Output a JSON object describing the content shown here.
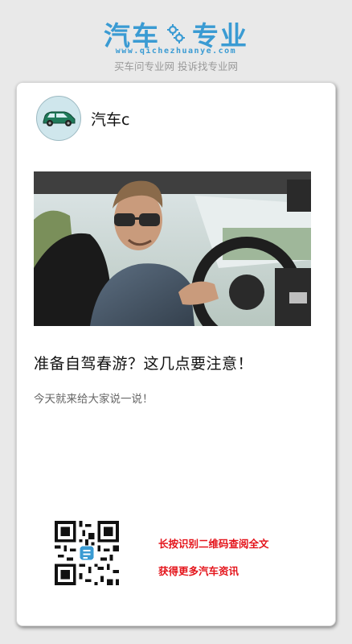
{
  "header": {
    "logo_left": "汽车",
    "logo_right": "专业",
    "domain": "www.qichezhuanye.com",
    "slogan": "买车问专业网 投诉找专业网"
  },
  "author": {
    "name": "汽车c",
    "avatar_icon": "car-icon"
  },
  "article": {
    "hero_image": "man-driving-car-photo",
    "title": "准备自驾春游？这几点要注意！",
    "subtitle": "今天就来给大家说一说！"
  },
  "share": {
    "qr_icon": "qr-code-icon",
    "line1": "长按识别二维码查阅全文",
    "line2": "获得更多汽车资讯"
  },
  "colors": {
    "brand": "#3a9bd3",
    "accent_red": "#e4141b",
    "background": "#e9e9e9"
  }
}
